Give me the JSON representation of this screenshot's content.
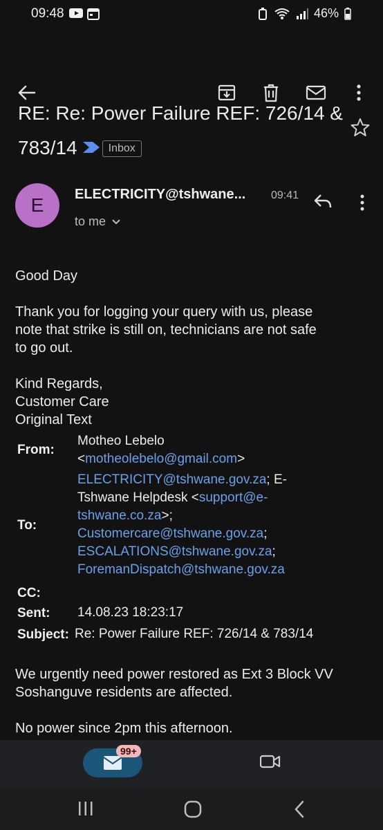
{
  "status": {
    "time": "09:48",
    "battery": "46%"
  },
  "email": {
    "subject": "RE: Re: Power Failure REF: 726/14 & 783/14",
    "label": "Inbox",
    "avatar_letter": "E",
    "sender": "ELECTRICITY@tshwane...",
    "time": "09:41",
    "recipient": "to me"
  },
  "body": {
    "greeting": "Good Day",
    "para1_line1": "Thank you for logging your query with us, please",
    "para1_line2": "note that strike is still on, technicians are not safe",
    "para1_line3": "to go out.",
    "closing1": "Kind Regards,",
    "closing2": "Customer Care",
    "closing3": "Original Text"
  },
  "meta": {
    "from_label": "From:",
    "from_name": "Motheo Lebelo",
    "from_lt": "<",
    "from_email": "motheolebelo@gmail.com",
    "from_gt": ">",
    "to_label": "To:",
    "to_email1": "ELECTRICITY@tshwane.gov.za",
    "to_sep1": "; E-",
    "to_name2": "Tshwane Helpdesk <",
    "to_email2a": "support@e-",
    "to_email2b": "tshwane.co.za",
    "to_sep2": ">;",
    "to_email3": "Customercare@tshwane.gov.za",
    "to_sep3": ";",
    "to_email4": "ESCALATIONS@tshwane.gov.za",
    "to_sep4": ";",
    "to_email5": "ForemanDispatch@tshwane.gov.za",
    "cc_label": "CC:",
    "sent_label": "Sent:",
    "sent_value": "14.08.23 18:23:17",
    "subject_label": "Subject:",
    "subject_value": "Re: Power Failure REF: 726/14 & 783/14"
  },
  "body2": {
    "line1": "We urgently need power restored as Ext 3 Block VV",
    "line2": "Soshanguve residents are affected.",
    "line3": "No power since 2pm this afternoon."
  },
  "nav": {
    "mail_badge": "99+"
  },
  "icons": [
    "back-arrow-icon",
    "archive-icon",
    "delete-icon",
    "mail-icon",
    "more-vert-icon",
    "star-icon",
    "reply-icon",
    "chevron-down-icon",
    "video-icon"
  ]
}
